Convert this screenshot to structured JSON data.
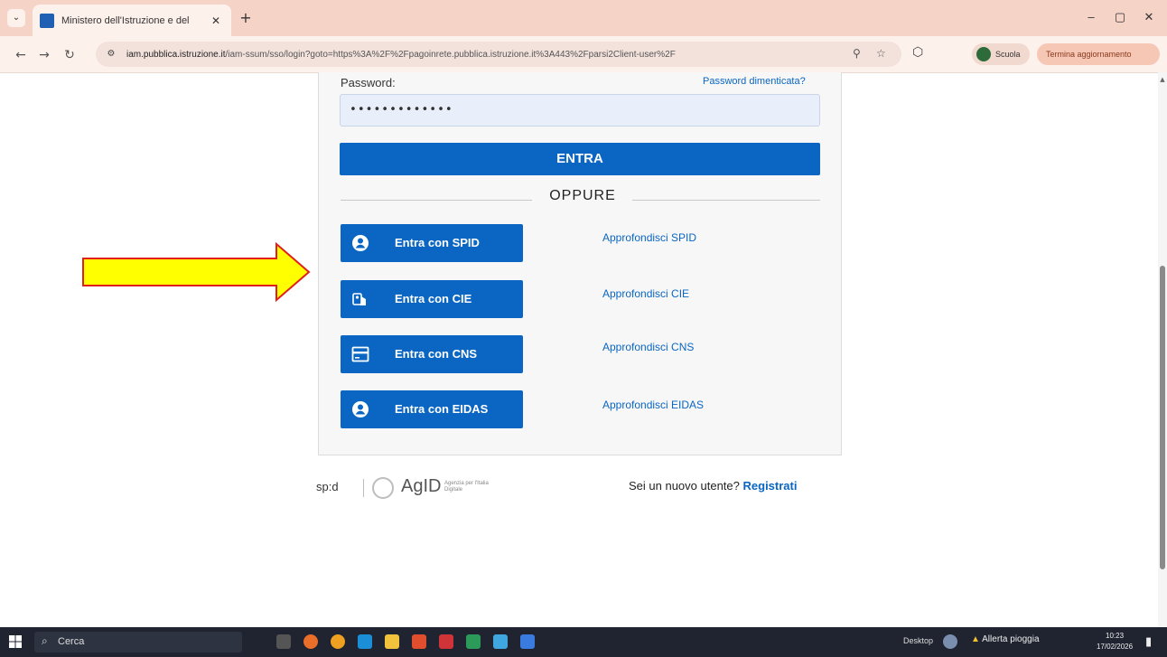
{
  "browser": {
    "tab_title": "Ministero dell'Istruzione e del",
    "tab_close": "✕",
    "new_tab": "+",
    "tab_list": "⌄",
    "url_domain": "iam.pubblica.istruzione.it",
    "url_path": "/iam-ssum/sso/login?goto=https%3A%2F%2Fpagoinrete.pubblica.istruzione.it%3A443%2Fparsi2Client-user%2F",
    "profile_label": "Scuola",
    "update_label": "Termina aggiornamento",
    "window_controls": [
      "–",
      "▢",
      "✕"
    ]
  },
  "login": {
    "password_label": "Password:",
    "forgot_password": "Password dimenticata?",
    "password_value": "•••••••••••••",
    "enter_button": "ENTRA",
    "or_separator": "OPPURE"
  },
  "auth_options": [
    {
      "label": "Entra con SPID",
      "learn_more": "Approfondisci SPID",
      "icon": "user-circle-icon"
    },
    {
      "label": "Entra con CIE",
      "learn_more": "Approfondisci CIE",
      "icon": "id-card-hand-icon"
    },
    {
      "label": "Entra con CNS",
      "learn_more": "Approfondisci CNS",
      "icon": "card-icon"
    },
    {
      "label": "Entra con EIDAS",
      "learn_more": "Approfondisci EIDAS",
      "icon": "user-circle-icon"
    }
  ],
  "footer": {
    "spid_logo": "sp:d",
    "agid_logo": "AgID",
    "agid_subtitle": "Agenzia per l'Italia Digitale",
    "new_user_prompt": "Sei un nuovo utente?",
    "register_link": "Registrati"
  },
  "taskbar": {
    "search_placeholder": "Cerca",
    "desktop_label": "Desktop",
    "weather_label": "Allerta pioggia",
    "clock_time": "10:23",
    "clock_date": "17/02/2026"
  },
  "colors": {
    "primary_blue": "#0a66c2",
    "chrome_bg": "#f6d3c7",
    "arrow_fill": "#ffff00",
    "arrow_stroke": "#e0201b"
  }
}
